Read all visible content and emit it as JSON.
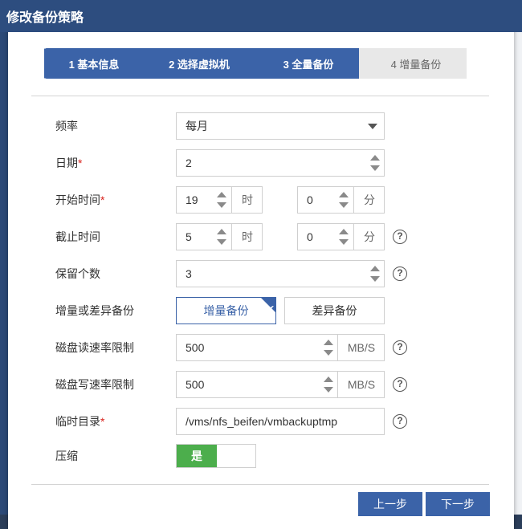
{
  "dialog": {
    "title": "修改备份策略"
  },
  "steps": [
    {
      "label": "1 基本信息",
      "state": "done"
    },
    {
      "label": "2 选择虚拟机",
      "state": "done"
    },
    {
      "label": "3 全量备份",
      "state": "current"
    },
    {
      "label": "4 增量备份",
      "state": "pending"
    }
  ],
  "form": {
    "frequency": {
      "label": "频率",
      "value": "每月"
    },
    "date": {
      "label": "日期",
      "required_mark": "*",
      "value": "2"
    },
    "start_time": {
      "label": "开始时间",
      "required_mark": "*",
      "hour": "19",
      "hour_unit": "时",
      "minute": "0",
      "minute_unit": "分"
    },
    "end_time": {
      "label": "截止时间",
      "hour": "5",
      "hour_unit": "时",
      "minute": "0",
      "minute_unit": "分"
    },
    "retain_count": {
      "label": "保留个数",
      "value": "3"
    },
    "backup_mode": {
      "label": "增量或差异备份",
      "options": [
        "增量备份",
        "差异备份"
      ],
      "selected": "增量备份"
    },
    "disk_read_limit": {
      "label": "磁盘读速率限制",
      "value": "500",
      "unit": "MB/S"
    },
    "disk_write_limit": {
      "label": "磁盘写速率限制",
      "value": "500",
      "unit": "MB/S"
    },
    "temp_dir": {
      "label": "临时目录",
      "required_mark": "*",
      "value": "/vms/nfs_beifen/vmbackuptmp"
    },
    "compress": {
      "label": "压缩",
      "on_label": "是",
      "enabled": true
    }
  },
  "footer": {
    "prev_label": "上一步",
    "next_label": "下一步"
  },
  "help_glyph": "?",
  "check_glyph": "✔",
  "colors": {
    "header": "#2d4d7f",
    "accent": "#3b63a8",
    "switch_on": "#4cae4c",
    "required": "#d9221c"
  }
}
